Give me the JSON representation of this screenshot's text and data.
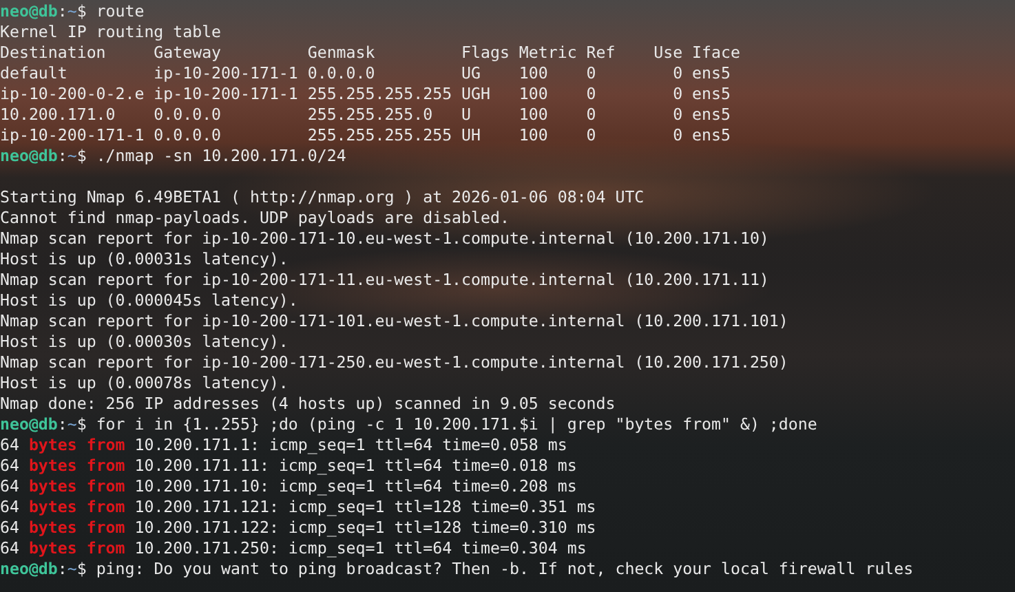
{
  "terminal": {
    "lines": [
      {
        "kind": "prompt",
        "user_host": "neo@db",
        "separator": ":",
        "path": "~",
        "sign": "$",
        "command": "route"
      },
      {
        "kind": "text",
        "text": "Kernel IP routing table"
      },
      {
        "kind": "text",
        "text": "Destination     Gateway         Genmask         Flags Metric Ref    Use Iface"
      },
      {
        "kind": "text",
        "text": "default         ip-10-200-171-1 0.0.0.0         UG    100    0        0 ens5"
      },
      {
        "kind": "text",
        "text": "ip-10-200-0-2.e ip-10-200-171-1 255.255.255.255 UGH   100    0        0 ens5"
      },
      {
        "kind": "text",
        "text": "10.200.171.0    0.0.0.0         255.255.255.0   U     100    0        0 ens5"
      },
      {
        "kind": "text",
        "text": "ip-10-200-171-1 0.0.0.0         255.255.255.255 UH    100    0        0 ens5"
      },
      {
        "kind": "prompt",
        "user_host": "neo@db",
        "separator": ":",
        "path": "~",
        "sign": "$",
        "command": "./nmap -sn 10.200.171.0/24"
      },
      {
        "kind": "blank"
      },
      {
        "kind": "text",
        "text": "Starting Nmap 6.49BETA1 ( http://nmap.org ) at 2026-01-06 08:04 UTC"
      },
      {
        "kind": "text",
        "text": "Cannot find nmap-payloads. UDP payloads are disabled."
      },
      {
        "kind": "text",
        "text": "Nmap scan report for ip-10-200-171-10.eu-west-1.compute.internal (10.200.171.10)"
      },
      {
        "kind": "text",
        "text": "Host is up (0.00031s latency)."
      },
      {
        "kind": "text",
        "text": "Nmap scan report for ip-10-200-171-11.eu-west-1.compute.internal (10.200.171.11)"
      },
      {
        "kind": "text",
        "text": "Host is up (0.000045s latency)."
      },
      {
        "kind": "text",
        "text": "Nmap scan report for ip-10-200-171-101.eu-west-1.compute.internal (10.200.171.101)"
      },
      {
        "kind": "text",
        "text": "Host is up (0.00030s latency)."
      },
      {
        "kind": "text",
        "text": "Nmap scan report for ip-10-200-171-250.eu-west-1.compute.internal (10.200.171.250)"
      },
      {
        "kind": "text",
        "text": "Host is up (0.00078s latency)."
      },
      {
        "kind": "text",
        "text": "Nmap done: 256 IP addresses (4 hosts up) scanned in 9.05 seconds"
      },
      {
        "kind": "prompt",
        "user_host": "neo@db",
        "separator": ":",
        "path": "~",
        "sign": "$",
        "command": "for i in {1..255} ;do (ping -c 1 10.200.171.$i | grep \"bytes from\" &) ;done"
      },
      {
        "kind": "match",
        "before": "64 ",
        "match": "bytes from",
        "after": " 10.200.171.1: icmp_seq=1 ttl=64 time=0.058 ms"
      },
      {
        "kind": "match",
        "before": "64 ",
        "match": "bytes from",
        "after": " 10.200.171.11: icmp_seq=1 ttl=64 time=0.018 ms"
      },
      {
        "kind": "match",
        "before": "64 ",
        "match": "bytes from",
        "after": " 10.200.171.10: icmp_seq=1 ttl=64 time=0.208 ms"
      },
      {
        "kind": "match",
        "before": "64 ",
        "match": "bytes from",
        "after": " 10.200.171.121: icmp_seq=1 ttl=128 time=0.351 ms"
      },
      {
        "kind": "match",
        "before": "64 ",
        "match": "bytes from",
        "after": " 10.200.171.122: icmp_seq=1 ttl=128 time=0.310 ms"
      },
      {
        "kind": "match",
        "before": "64 ",
        "match": "bytes from",
        "after": " 10.200.171.250: icmp_seq=1 ttl=64 time=0.304 ms"
      },
      {
        "kind": "prompt",
        "user_host": "neo@db",
        "separator": ":",
        "path": "~",
        "sign": "$",
        "command": "ping: Do you want to ping broadcast? Then -b. If not, check your local firewall rules"
      }
    ]
  }
}
